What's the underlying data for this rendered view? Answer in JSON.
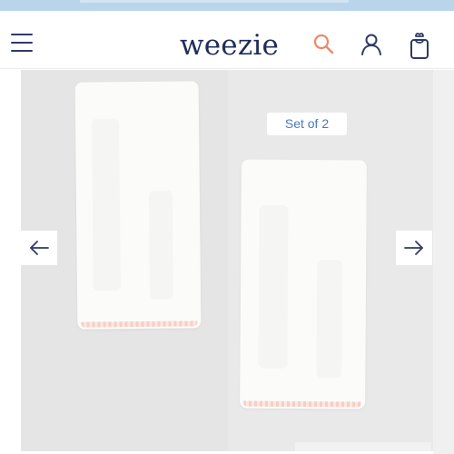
{
  "brand": {
    "logo_text": "weezie"
  },
  "header": {
    "menu_icon": "hamburger-menu-icon",
    "search_icon": "search-icon",
    "account_icon": "user-icon",
    "cart_icon": "shopping-bag-icon"
  },
  "gallery": {
    "badge": "Set of 2",
    "prev_icon": "arrow-left-icon",
    "next_icon": "arrow-right-icon"
  },
  "colors": {
    "announcement_bar": "#b9d5ec",
    "brand_navy": "#1f2d5c",
    "search_accent": "#e98a6a",
    "badge_text": "#4a78c6",
    "towel_trim": "#f4cfc6"
  }
}
